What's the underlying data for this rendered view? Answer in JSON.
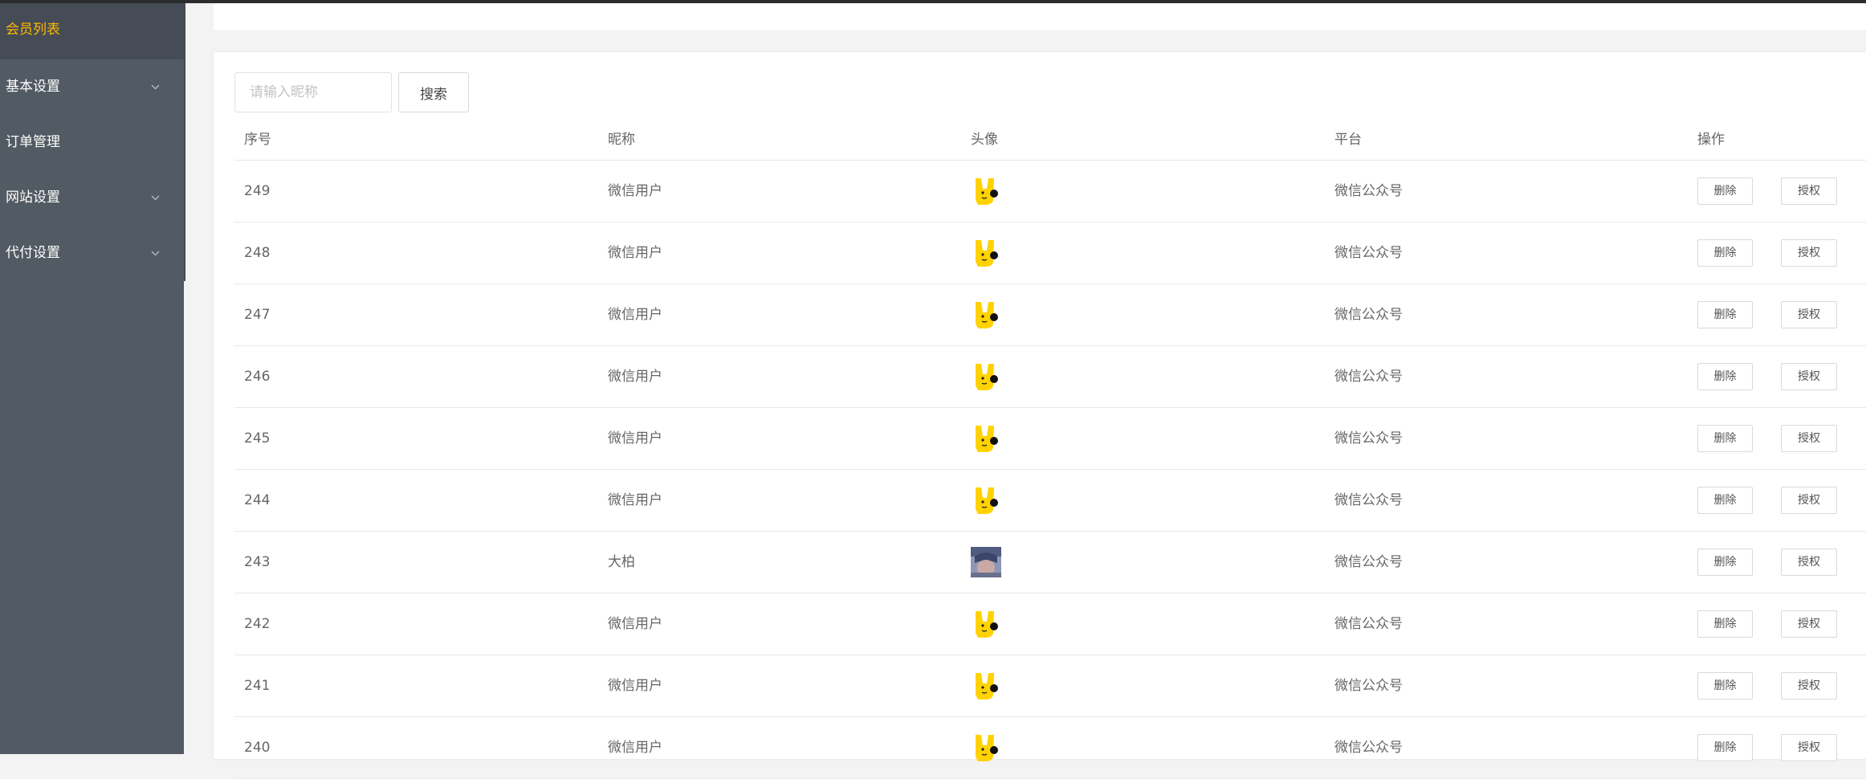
{
  "sidebar": {
    "items": [
      {
        "label": "会员列表",
        "active": true,
        "has_submenu": false
      },
      {
        "label": "基本设置",
        "active": false,
        "has_submenu": true
      },
      {
        "label": "订单管理",
        "active": false,
        "has_submenu": false
      },
      {
        "label": "网站设置",
        "active": false,
        "has_submenu": true
      },
      {
        "label": "代付设置",
        "active": false,
        "has_submenu": true
      }
    ]
  },
  "search": {
    "placeholder": "请输入昵称",
    "value": "",
    "button_label": "搜索"
  },
  "table": {
    "columns": [
      "序号",
      "昵称",
      "头像",
      "平台",
      "操作"
    ],
    "rows": [
      {
        "id": "249",
        "nickname": "微信用户",
        "avatar": "yellow-cartoon-avatar",
        "platform": "微信公众号"
      },
      {
        "id": "248",
        "nickname": "微信用户",
        "avatar": "yellow-cartoon-avatar",
        "platform": "微信公众号"
      },
      {
        "id": "247",
        "nickname": "微信用户",
        "avatar": "yellow-cartoon-avatar",
        "platform": "微信公众号"
      },
      {
        "id": "246",
        "nickname": "微信用户",
        "avatar": "yellow-cartoon-avatar",
        "platform": "微信公众号"
      },
      {
        "id": "245",
        "nickname": "微信用户",
        "avatar": "yellow-cartoon-avatar",
        "platform": "微信公众号"
      },
      {
        "id": "244",
        "nickname": "微信用户",
        "avatar": "yellow-cartoon-avatar",
        "platform": "微信公众号"
      },
      {
        "id": "243",
        "nickname": "大柏",
        "avatar": "photo-avatar",
        "platform": "微信公众号"
      },
      {
        "id": "242",
        "nickname": "微信用户",
        "avatar": "yellow-cartoon-avatar",
        "platform": "微信公众号"
      },
      {
        "id": "241",
        "nickname": "微信用户",
        "avatar": "yellow-cartoon-avatar",
        "platform": "微信公众号"
      },
      {
        "id": "240",
        "nickname": "微信用户",
        "avatar": "yellow-cartoon-avatar",
        "platform": "微信公众号"
      }
    ],
    "delete_label": "删除",
    "authorize_label": "授权"
  },
  "colors": {
    "sidebar_bg": "#525a63",
    "sidebar_active_bg": "#454c55",
    "sidebar_active_text": "#ffb800",
    "avatar_yellow": "#ffd200"
  }
}
